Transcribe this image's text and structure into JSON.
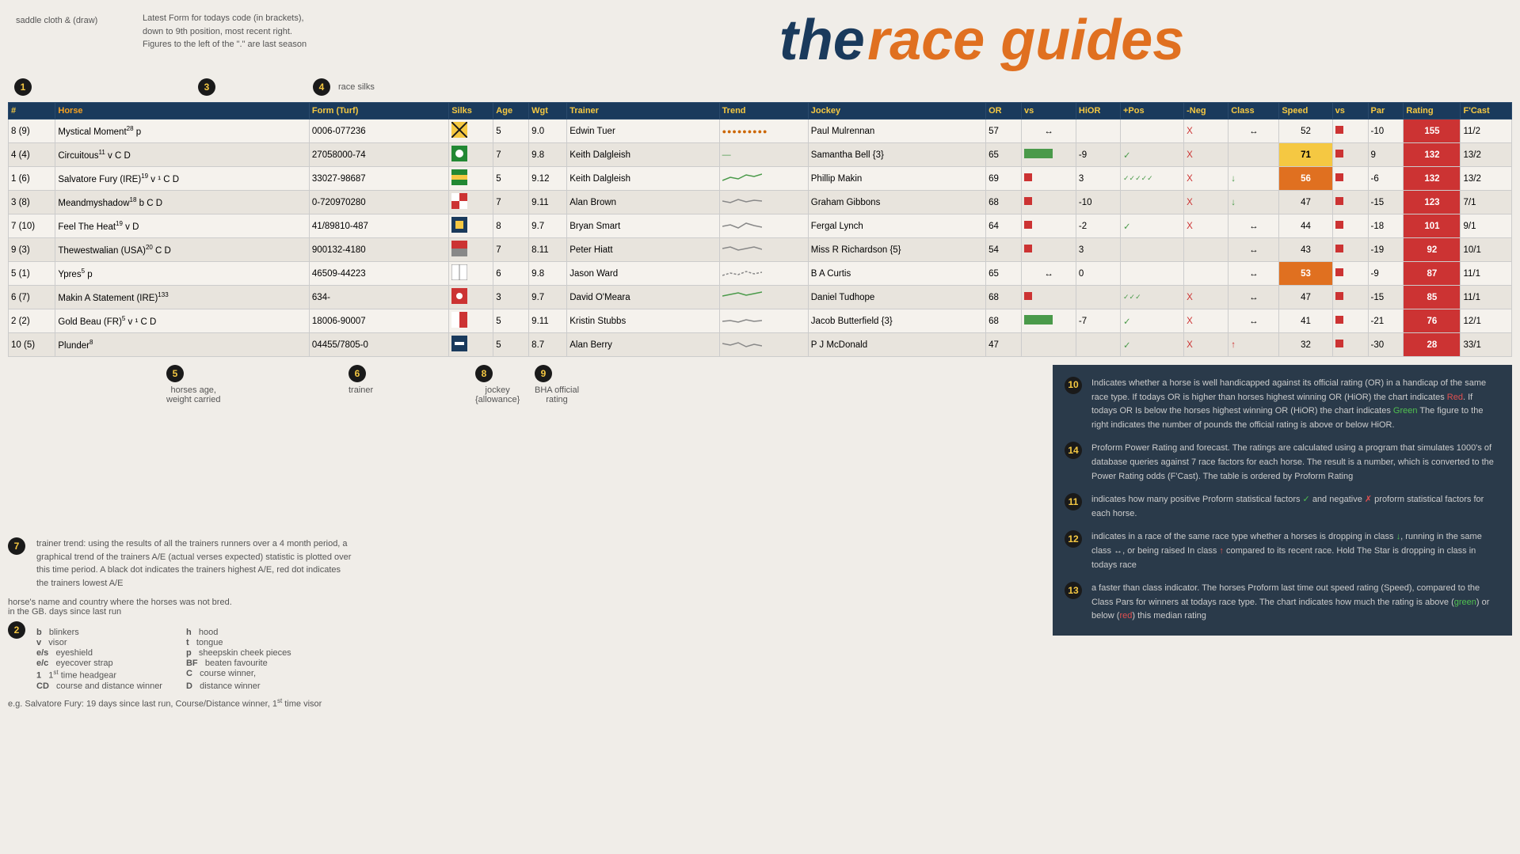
{
  "header": {
    "saddle_label": "saddle cloth\n& (draw)",
    "desc_line1": "Latest Form for todays code (in brackets),",
    "desc_line2": "down to 9th position, most recent right.",
    "desc_line3": "Figures to the left of the \".\" are last season",
    "title_the": "the",
    "title_race": "race guides",
    "silks_label": "race silks"
  },
  "table": {
    "headers": [
      "#",
      "Horse",
      "Form (Turf)",
      "Silks",
      "Age",
      "Wgt",
      "Trainer",
      "Trend",
      "Jockey",
      "OR",
      "vs",
      "HiOR",
      "+Pos",
      "-Neg",
      "Class",
      "Speed",
      "vs",
      "Par",
      "Rating",
      "F'Cast"
    ],
    "rows": [
      {
        "num": "8 (9)",
        "horse": "Mystical Moment",
        "horse_sup": "28",
        "horse_suffix": "p",
        "form": "0006-077236",
        "age": "5",
        "wgt": "9.0",
        "trainer": "Edwin Tuer",
        "jockey": "Paul Mulrennan",
        "or": "57",
        "vs": "↔",
        "hior": "",
        "pos": "",
        "neg": "X",
        "class": "↔",
        "speed": "52",
        "vs2": "",
        "par": "-10",
        "rating": "155",
        "fcast": "11/2",
        "trend_dots": "●●●●●●●●●",
        "trend_color": "orange",
        "silks_color": "yellow_cross",
        "vs_bar": false,
        "hior_val": "",
        "pos_checks": "",
        "neg_x": true,
        "rating_val": "155",
        "rating_class": "rating-red"
      },
      {
        "num": "4 (4)",
        "horse": "Circuitous",
        "horse_sup": "11",
        "horse_suffix": "v C D",
        "form": "27058000-74",
        "age": "7",
        "wgt": "9.8",
        "trainer": "Keith Dalgleish",
        "jockey": "Samantha Bell {3}",
        "or": "65",
        "vs": "green_bar",
        "hior": "-9",
        "pos": "✓",
        "neg": "X",
        "class": "",
        "speed": "71",
        "vs2": "red",
        "par": "9",
        "rating": "132",
        "fcast": "13/2",
        "trend_dots": "—",
        "trend_color": "green",
        "silks_color": "green_flag",
        "vs_bar": true,
        "highlight_speed": "highlight-yellow",
        "rating_class": "rating-red"
      },
      {
        "num": "1 (6)",
        "horse": "Salvatore Fury (IRE)",
        "horse_sup": "19",
        "horse_suffix": "v ¹ C D",
        "form": "33027-98687",
        "age": "5",
        "wgt": "9.12",
        "trainer": "Keith Dalgleish",
        "jockey": "Phillip Makin",
        "or": "69",
        "vs": "red",
        "hior": "3",
        "pos": "✓✓✓✓✓",
        "neg": "X",
        "class": "↓",
        "speed": "56",
        "vs2": "red",
        "par": "-6",
        "rating": "132",
        "fcast": "13/2",
        "trend_dots": "~",
        "trend_color": "mixed",
        "silks_color": "striped",
        "vs_bar": false,
        "highlight_speed": "highlight-orange",
        "rating_class": "rating-red"
      },
      {
        "num": "3 (8)",
        "horse": "Meandmyshadow",
        "horse_sup": "18",
        "horse_suffix": "b C D",
        "form": "0-720970280",
        "age": "7",
        "wgt": "9.11",
        "trainer": "Alan Brown",
        "jockey": "Graham Gibbons",
        "or": "68",
        "vs": "red",
        "hior": "-10",
        "pos": "",
        "neg": "X",
        "class": "↓",
        "speed": "47",
        "vs2": "red",
        "par": "-15",
        "rating": "123",
        "fcast": "7/1",
        "rating_class": "rating-red"
      },
      {
        "num": "7 (10)",
        "horse": "Feel The Heat",
        "horse_sup": "19",
        "horse_suffix": "v D",
        "form": "41/89810-487",
        "age": "8",
        "wgt": "9.7",
        "trainer": "Bryan Smart",
        "jockey": "Fergal Lynch",
        "or": "64",
        "vs": "red",
        "hior": "-2",
        "pos": "✓",
        "neg": "X",
        "class": "↔",
        "speed": "44",
        "vs2": "red",
        "par": "-18",
        "rating": "101",
        "fcast": "9/1",
        "rating_class": "rating-red"
      },
      {
        "num": "9 (3)",
        "horse": "Thewestwalian (USA)",
        "horse_sup": "20",
        "horse_suffix": "C D",
        "form": "900132-4180",
        "age": "7",
        "wgt": "8.11",
        "trainer": "Peter Hiatt",
        "jockey": "Miss R Richardson {5}",
        "or": "54",
        "vs": "red",
        "hior": "3",
        "pos": "",
        "neg": "",
        "class": "↔",
        "speed": "43",
        "vs2": "red",
        "par": "-19",
        "rating": "92",
        "fcast": "10/1",
        "rating_class": "rating-red"
      },
      {
        "num": "5 (1)",
        "horse": "Ypres",
        "horse_sup": "5",
        "horse_suffix": "p",
        "form": "46509-44223",
        "age": "6",
        "wgt": "9.8",
        "trainer": "Jason Ward",
        "jockey": "B A Curtis",
        "or": "65",
        "vs": "",
        "hior": "0",
        "pos": "",
        "neg": "",
        "class": "↔",
        "speed": "53",
        "vs2": "red",
        "par": "-9",
        "rating": "87",
        "fcast": "11/1",
        "highlight_speed": "highlight-orange",
        "rating_class": "rating-red"
      },
      {
        "num": "6 (7)",
        "horse": "Makin A Statement (IRE)",
        "horse_sup": "133",
        "horse_suffix": "",
        "form": "634-",
        "age": "3",
        "wgt": "9.7",
        "trainer": "David O'Meara",
        "jockey": "Daniel Tudhope",
        "or": "68",
        "vs": "red",
        "hior": "",
        "pos": "✓✓✓",
        "neg": "X",
        "class": "↔",
        "speed": "47",
        "vs2": "red",
        "par": "-15",
        "rating": "85",
        "fcast": "11/1",
        "rating_class": "rating-red"
      },
      {
        "num": "2 (2)",
        "horse": "Gold Beau (FR)",
        "horse_sup": "5",
        "horse_suffix": "v ¹ C D",
        "form": "18006-90007",
        "age": "5",
        "wgt": "9.11",
        "trainer": "Kristin Stubbs",
        "jockey": "Jacob Butterfield {3}",
        "or": "68",
        "vs": "green_bar",
        "hior": "-7",
        "pos": "✓",
        "neg": "X",
        "class": "↔",
        "speed": "41",
        "vs2": "red",
        "par": "-21",
        "rating": "76",
        "fcast": "12/1",
        "rating_class": "rating-red"
      },
      {
        "num": "10 (5)",
        "horse": "Plunder",
        "horse_sup": "8",
        "horse_suffix": "",
        "form": "04455/7805-0",
        "age": "5",
        "wgt": "8.7",
        "trainer": "Alan Berry",
        "jockey": "P J McDonald",
        "or": "47",
        "vs": "",
        "hior": "",
        "pos": "✓",
        "neg": "X",
        "class": "↑",
        "speed": "32",
        "vs2": "red",
        "par": "-30",
        "rating": "28",
        "fcast": "33/1",
        "rating_class": "rating-red"
      }
    ]
  },
  "annotations": {
    "badge_1": "1",
    "badge_2": "2",
    "badge_3": "3",
    "badge_4": "4",
    "badge_5": "5",
    "badge_6": "6",
    "badge_7": "7",
    "badge_8": "8",
    "badge_9": "9",
    "badge_10": "10",
    "badge_11": "11",
    "badge_12": "12",
    "badge_13": "13",
    "badge_14": "14",
    "ann5_text": "horses age,\nweight carried",
    "ann6_text": "trainer",
    "ann7_text": "trainer trend: using the results of all the trainers runners over a 4 month period, a graphical trend of the trainers A/E (actual verses expected) statistic is plotted over this time period. A black dot indicates the trainers highest A/E, red dot indicates the trainers lowest A/E",
    "ann8_text": "jockey\n{allowance}",
    "ann9_text": "BHA official\nrating",
    "ann11_text": "indicates how many positive Proform statistical factors ✓ and negative ✗ proform statistical factors for each horse.",
    "ann12_text": "indicates in a race of the same race type whether a horses is dropping in class ↓, running in the same class ↔, or being raised In class ↑ compared to its recent race. Hold The Star is dropping in class in todays race",
    "ann13_text": "a faster than class indicator. The horses Proform last time out speed rating (Speed), compared to the Class Pars for winners at todays race type. The chart indicates how much the rating is above (green) or below (red) this median rating",
    "horse_name_note": "horse's name and country where the horses was not bred.\nin the GB. days since last run",
    "legend": [
      {
        "key": "b",
        "val": "blinkers"
      },
      {
        "key": "h",
        "val": "hood"
      },
      {
        "key": "v",
        "val": "visor"
      },
      {
        "key": "t",
        "val": "tongue"
      },
      {
        "key": "e/s",
        "val": "eyeshield"
      },
      {
        "key": "p",
        "val": "sheepskin cheek pieces"
      },
      {
        "key": "e/c",
        "val": "eyecover strap"
      },
      {
        "key": "BF",
        "val": "beaten favourite"
      },
      {
        "key": "1",
        "val": "1st time headgear"
      },
      {
        "key": "C",
        "val": "course winner,"
      },
      {
        "key": "CD",
        "val": "course and distance winner"
      },
      {
        "key": "D",
        "val": "distance winner"
      }
    ],
    "example_text": "e.g. Salvatore Fury: 19 days since last run, Course/Distance winner, 1st time visor",
    "right_panel": {
      "badge_10": "10",
      "text_10": "Indicates whether a horse is well handicapped against its official rating (OR) in a handicap of the same race type. If todays OR is higher than horses highest winning OR (HiOR) the chart indicates Red. If todays OR Is below the horses highest winning OR (HiOR) the chart indicates Green The figure to the right indicates the number of pounds the official rating is above or below HiOR.",
      "badge_14": "14",
      "text_14": "Proform Power Rating and forecast. The ratings are calculated using a program that simulates 1000's of database queries against 7 race factors for each horse. The result is a number, which is converted to the Power Rating odds (F'Cast). The table is ordered by Proform Rating"
    }
  }
}
